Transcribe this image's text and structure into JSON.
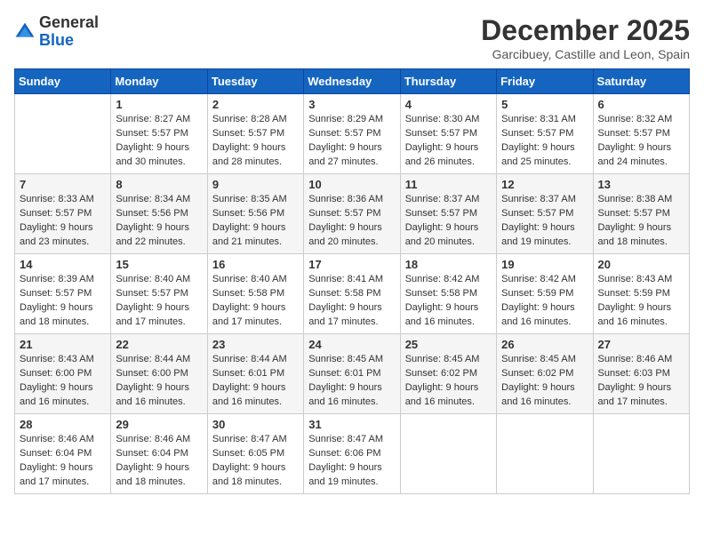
{
  "header": {
    "logo_general": "General",
    "logo_blue": "Blue",
    "month_title": "December 2025",
    "location": "Garcibuey, Castille and Leon, Spain"
  },
  "weekdays": [
    "Sunday",
    "Monday",
    "Tuesday",
    "Wednesday",
    "Thursday",
    "Friday",
    "Saturday"
  ],
  "weeks": [
    [
      {
        "day": "",
        "info": ""
      },
      {
        "day": "1",
        "info": "Sunrise: 8:27 AM\nSunset: 5:57 PM\nDaylight: 9 hours\nand 30 minutes."
      },
      {
        "day": "2",
        "info": "Sunrise: 8:28 AM\nSunset: 5:57 PM\nDaylight: 9 hours\nand 28 minutes."
      },
      {
        "day": "3",
        "info": "Sunrise: 8:29 AM\nSunset: 5:57 PM\nDaylight: 9 hours\nand 27 minutes."
      },
      {
        "day": "4",
        "info": "Sunrise: 8:30 AM\nSunset: 5:57 PM\nDaylight: 9 hours\nand 26 minutes."
      },
      {
        "day": "5",
        "info": "Sunrise: 8:31 AM\nSunset: 5:57 PM\nDaylight: 9 hours\nand 25 minutes."
      },
      {
        "day": "6",
        "info": "Sunrise: 8:32 AM\nSunset: 5:57 PM\nDaylight: 9 hours\nand 24 minutes."
      }
    ],
    [
      {
        "day": "7",
        "info": "Sunrise: 8:33 AM\nSunset: 5:57 PM\nDaylight: 9 hours\nand 23 minutes."
      },
      {
        "day": "8",
        "info": "Sunrise: 8:34 AM\nSunset: 5:56 PM\nDaylight: 9 hours\nand 22 minutes."
      },
      {
        "day": "9",
        "info": "Sunrise: 8:35 AM\nSunset: 5:56 PM\nDaylight: 9 hours\nand 21 minutes."
      },
      {
        "day": "10",
        "info": "Sunrise: 8:36 AM\nSunset: 5:57 PM\nDaylight: 9 hours\nand 20 minutes."
      },
      {
        "day": "11",
        "info": "Sunrise: 8:37 AM\nSunset: 5:57 PM\nDaylight: 9 hours\nand 20 minutes."
      },
      {
        "day": "12",
        "info": "Sunrise: 8:37 AM\nSunset: 5:57 PM\nDaylight: 9 hours\nand 19 minutes."
      },
      {
        "day": "13",
        "info": "Sunrise: 8:38 AM\nSunset: 5:57 PM\nDaylight: 9 hours\nand 18 minutes."
      }
    ],
    [
      {
        "day": "14",
        "info": "Sunrise: 8:39 AM\nSunset: 5:57 PM\nDaylight: 9 hours\nand 18 minutes."
      },
      {
        "day": "15",
        "info": "Sunrise: 8:40 AM\nSunset: 5:57 PM\nDaylight: 9 hours\nand 17 minutes."
      },
      {
        "day": "16",
        "info": "Sunrise: 8:40 AM\nSunset: 5:58 PM\nDaylight: 9 hours\nand 17 minutes."
      },
      {
        "day": "17",
        "info": "Sunrise: 8:41 AM\nSunset: 5:58 PM\nDaylight: 9 hours\nand 17 minutes."
      },
      {
        "day": "18",
        "info": "Sunrise: 8:42 AM\nSunset: 5:58 PM\nDaylight: 9 hours\nand 16 minutes."
      },
      {
        "day": "19",
        "info": "Sunrise: 8:42 AM\nSunset: 5:59 PM\nDaylight: 9 hours\nand 16 minutes."
      },
      {
        "day": "20",
        "info": "Sunrise: 8:43 AM\nSunset: 5:59 PM\nDaylight: 9 hours\nand 16 minutes."
      }
    ],
    [
      {
        "day": "21",
        "info": "Sunrise: 8:43 AM\nSunset: 6:00 PM\nDaylight: 9 hours\nand 16 minutes."
      },
      {
        "day": "22",
        "info": "Sunrise: 8:44 AM\nSunset: 6:00 PM\nDaylight: 9 hours\nand 16 minutes."
      },
      {
        "day": "23",
        "info": "Sunrise: 8:44 AM\nSunset: 6:01 PM\nDaylight: 9 hours\nand 16 minutes."
      },
      {
        "day": "24",
        "info": "Sunrise: 8:45 AM\nSunset: 6:01 PM\nDaylight: 9 hours\nand 16 minutes."
      },
      {
        "day": "25",
        "info": "Sunrise: 8:45 AM\nSunset: 6:02 PM\nDaylight: 9 hours\nand 16 minutes."
      },
      {
        "day": "26",
        "info": "Sunrise: 8:45 AM\nSunset: 6:02 PM\nDaylight: 9 hours\nand 16 minutes."
      },
      {
        "day": "27",
        "info": "Sunrise: 8:46 AM\nSunset: 6:03 PM\nDaylight: 9 hours\nand 17 minutes."
      }
    ],
    [
      {
        "day": "28",
        "info": "Sunrise: 8:46 AM\nSunset: 6:04 PM\nDaylight: 9 hours\nand 17 minutes."
      },
      {
        "day": "29",
        "info": "Sunrise: 8:46 AM\nSunset: 6:04 PM\nDaylight: 9 hours\nand 18 minutes."
      },
      {
        "day": "30",
        "info": "Sunrise: 8:47 AM\nSunset: 6:05 PM\nDaylight: 9 hours\nand 18 minutes."
      },
      {
        "day": "31",
        "info": "Sunrise: 8:47 AM\nSunset: 6:06 PM\nDaylight: 9 hours\nand 19 minutes."
      },
      {
        "day": "",
        "info": ""
      },
      {
        "day": "",
        "info": ""
      },
      {
        "day": "",
        "info": ""
      }
    ]
  ]
}
